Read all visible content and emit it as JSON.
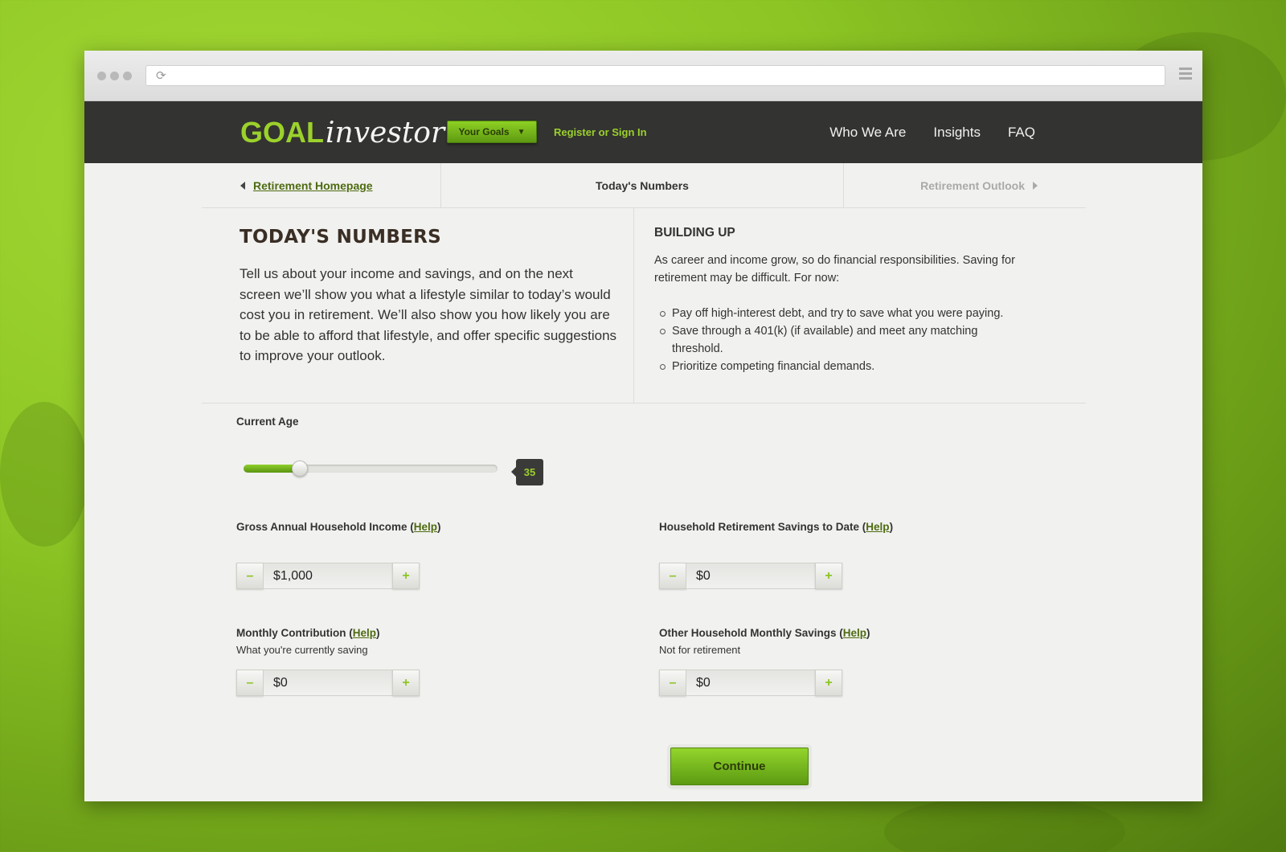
{
  "browser": {
    "url": ""
  },
  "brand": {
    "goal": "GOAL",
    "investor": "investor",
    "reg": "®"
  },
  "nav": {
    "your_goals": "Your Goals",
    "register": "Register or Sign In",
    "links": [
      "Who We Are",
      "Insights",
      "FAQ"
    ]
  },
  "breadcrumbs": {
    "previous": "Retirement Homepage",
    "current": "Today's Numbers",
    "next": "Retirement Outlook"
  },
  "intro": {
    "title": "TODAY'S NUMBERS",
    "text": "Tell us about your income and savings, and on the next screen we’ll show you what a lifestyle similar to today’s would cost you in retirement. We’ll also show you how likely you are to be able to afford that lifestyle, and offer specific suggestions to improve your outlook."
  },
  "sidebar": {
    "title": "BUILDING UP",
    "text": "As career and income grow, so do financial responsibilities.  Saving for retirement may be difficult.  For now:",
    "bullets": [
      "Pay off high-interest debt, and try to save what you were paying.",
      "Save through a 401(k) (if available) and meet any matching threshold.",
      "Prioritize competing financial demands."
    ]
  },
  "age": {
    "label": "Current Age",
    "value": "35",
    "fill_fraction": 0.22
  },
  "fields": {
    "income": {
      "label": "Gross Annual Household Income (",
      "help": "Help",
      "close": ")",
      "value": "$1,000"
    },
    "savings": {
      "label": "Household Retirement Savings to Date (",
      "help": "Help",
      "close": ")",
      "value": "$0"
    },
    "contribution": {
      "label": "Monthly Contribution (",
      "help": "Help",
      "close": ")",
      "sub": "What you're currently saving",
      "value": "$0"
    },
    "other": {
      "label": "Other Household Monthly Savings (",
      "help": "Help",
      "close": ")",
      "sub": "Not for retirement",
      "value": "$0"
    }
  },
  "stepper": {
    "minus": "–",
    "plus": "+"
  },
  "continue_label": "Continue",
  "colors": {
    "accent": "#8cc524",
    "dark_nav": "#333331"
  }
}
